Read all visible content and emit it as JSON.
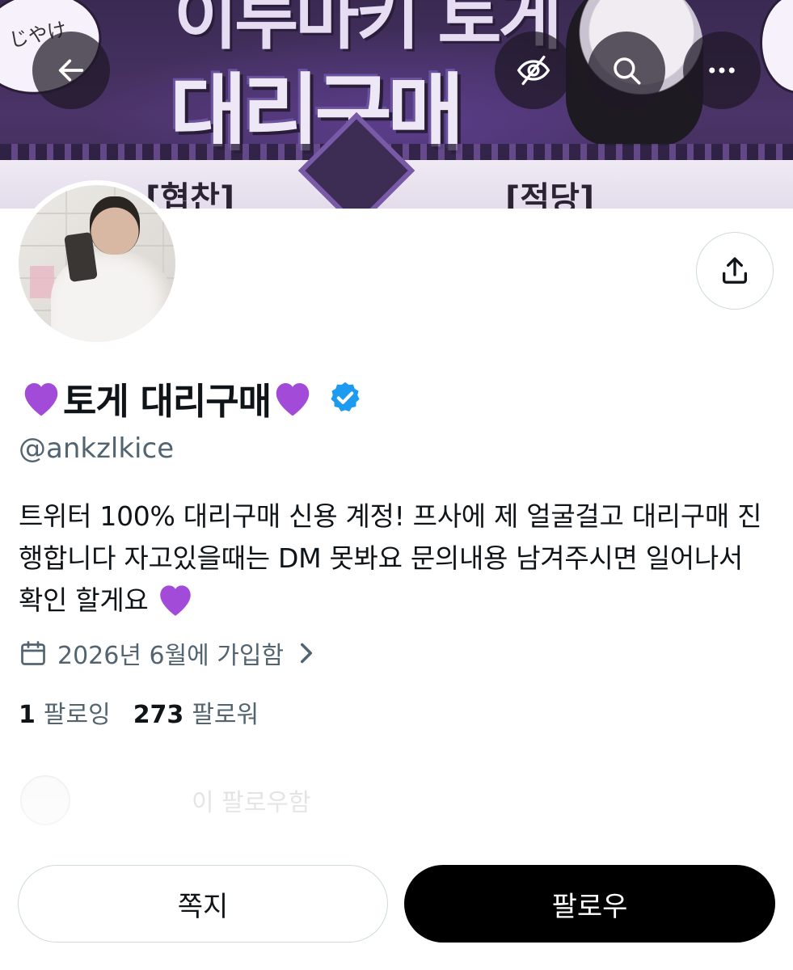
{
  "banner": {
    "title_top": "이루마키 토게",
    "title_main": "대리구매",
    "sub_left": "[협찬]",
    "sub_right": "[적당]",
    "speech_text": "じやけ"
  },
  "nav": {
    "back_icon": "arrow-left-icon",
    "hide_icon": "eye-slash-icon",
    "search_icon": "search-icon",
    "more_icon": "more-icon"
  },
  "profile": {
    "display_name": "토게 대리구매",
    "handle": "@ankzlkice",
    "verified": true,
    "verified_color": "#1d9bf0",
    "heart_color": "#a24bd8",
    "bio": "트위터 100% 대리구매 신용 계정! 프사에 제 얼굴걸고 대리구매 진행합니다 자고있을때는 DM 못봐요 문의내용 남겨주시면 일어나서 확인 할게요",
    "joined": "2026년 6월에 가입함",
    "following_count": "1",
    "following_label": "팔로잉",
    "followers_count": "273",
    "followers_label": "팔로워",
    "followed_by_text": "이 팔로우함"
  },
  "actions": {
    "message_label": "쪽지",
    "follow_label": "팔로우"
  }
}
